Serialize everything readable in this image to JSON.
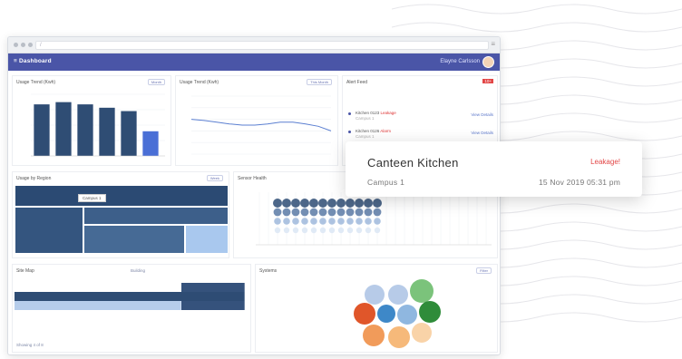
{
  "browser": {
    "url": "/",
    "menu_glyph": "≡"
  },
  "app": {
    "brand": "≡ Dashboard",
    "user_name": "Elayne Carlsson"
  },
  "panels": {
    "usage_bar": {
      "title": "Usage Trend (Kwh)",
      "pill": "Month"
    },
    "usage_line": {
      "title": "Usage Trend (Kwh)",
      "pill": "This Month"
    },
    "alerts": {
      "title": "Alert Feed",
      "badge": "10+",
      "items": [
        {
          "title": "Kitchen 0123",
          "label": "Leakage",
          "sub": "Campus 1",
          "link": "View Details"
        },
        {
          "title": "Kitchen 0126",
          "label": "Alarm",
          "sub": "Campus 1",
          "link": "View Details"
        }
      ]
    },
    "treemap": {
      "title": "Usage by Region",
      "pill": "Week",
      "tooltip": "Campus 1"
    },
    "scatter": {
      "title": "Sensor Health"
    },
    "table": {
      "title": "Site Map",
      "middle_title": "Building",
      "footer": "Showing 4 of 8"
    },
    "bubbles": {
      "title": "Systems",
      "pill": "Filter"
    }
  },
  "chart_data": [
    {
      "type": "bar",
      "categories": [
        "",
        "",
        "",
        "",
        "",
        ""
      ],
      "values": [
        92,
        96,
        92,
        86,
        80,
        44
      ],
      "ylim": [
        0,
        110
      ]
    },
    {
      "type": "line",
      "x": [
        1,
        2,
        3,
        4,
        5,
        6,
        7,
        8,
        9,
        10,
        11,
        12
      ],
      "series": [
        {
          "values": [
            60,
            58,
            55,
            52,
            50,
            50,
            52,
            55,
            55,
            52,
            48,
            40
          ]
        }
      ],
      "ylim": [
        0,
        100
      ],
      "grid": true
    }
  ],
  "card": {
    "title": "Canteen Kitchen",
    "status": "Leakage!",
    "subtitle": "Campus 1",
    "timestamp": "15 Nov 2019 05:31 pm"
  },
  "colors": {
    "appbar": "#4a55a7",
    "bar": "#2f4d74",
    "bar_highlight": "#4a6fd6",
    "alert": "#e24646"
  }
}
